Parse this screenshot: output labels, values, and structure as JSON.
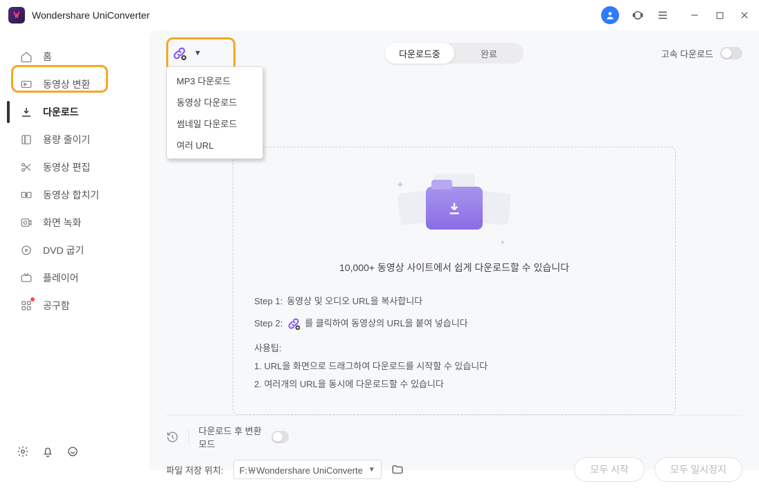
{
  "app": {
    "title": "Wondershare UniConverter"
  },
  "sidebar": {
    "items": [
      {
        "label": "홈"
      },
      {
        "label": "동영상 변환"
      },
      {
        "label": "다운로드"
      },
      {
        "label": "용량 줄이기"
      },
      {
        "label": "동영상 편집"
      },
      {
        "label": "동영상 합치기"
      },
      {
        "label": "화면 녹화"
      },
      {
        "label": "DVD 굽기"
      },
      {
        "label": "플레이어"
      },
      {
        "label": "공구함"
      }
    ]
  },
  "dropdown": {
    "items": [
      {
        "label": "MP3 다운로드"
      },
      {
        "label": "동영상 다운로드"
      },
      {
        "label": "썸네일 다운로드"
      },
      {
        "label": "여러 URL"
      }
    ]
  },
  "tabs": {
    "downloading": "다운로드중",
    "done": "완료"
  },
  "fast_label": "고속 다운로드",
  "hero_text": "10,000+ 동영상 사이트에서 쉽게 다운로드할 수 있습니다",
  "steps": {
    "s1_label": "Step 1:",
    "s1_text": "동영상 및 오디오 URL을 복사합니다",
    "s2_label": "Step 2:",
    "s2_text": "를 클릭하여 동영상의 URL을 붙여 넣습니다",
    "tips_label": "사용팁:",
    "tip1": "1. URL을 화면으로 드래그하여 다운로드를 시작할 수 있습니다",
    "tip2": "2. 여러개의 URL을 동시에 다운로드할 수 있습니다"
  },
  "footer": {
    "convert_label": "다운로드 후 변환 모드",
    "path_label": "파일 저장 위치:",
    "path_value": "F:￦Wondershare UniConverte",
    "start_all": "모두 시작",
    "pause_all": "모두 일시정지"
  }
}
